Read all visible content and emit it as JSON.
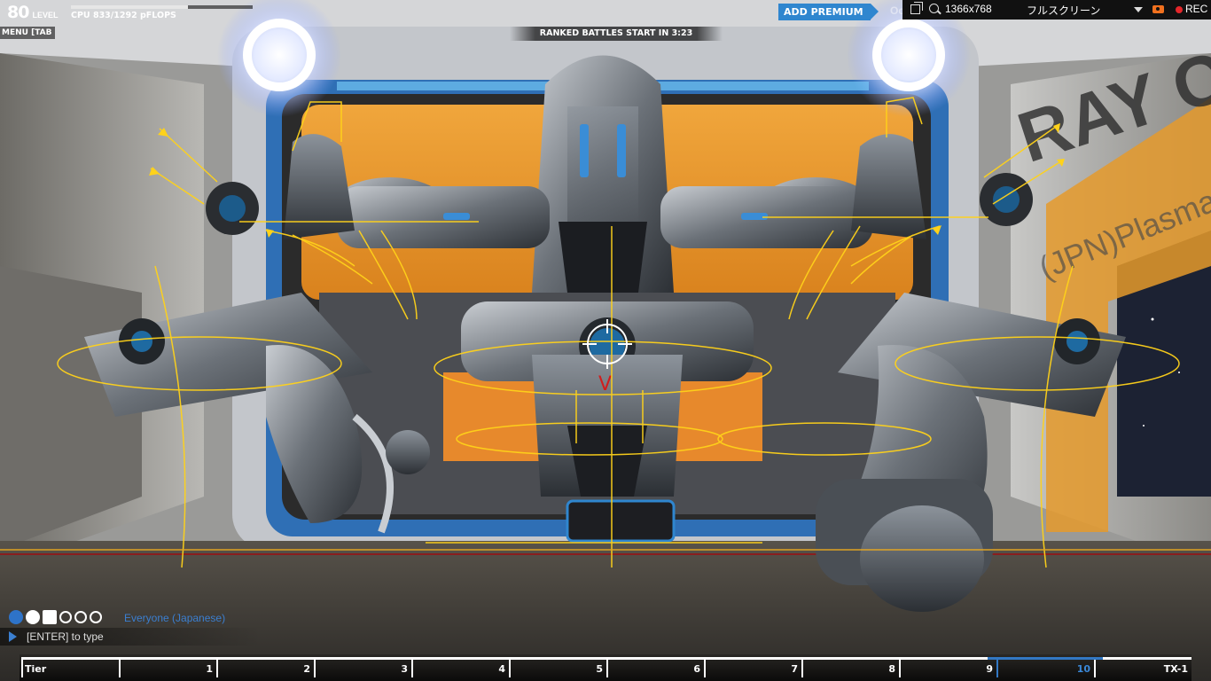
{
  "hud": {
    "level": "80",
    "level_label": "LEVEL",
    "cpu_text": "CPU 833/1292 pFLOPS",
    "cpu_fraction": 0.645,
    "menu_label": "MENU [TAB",
    "ranked_banner": "RANKED BATTLES START IN 3:23",
    "premium_label": "ADD PREMIUM",
    "premium_trail": "Oc"
  },
  "recorder": {
    "resolution": "1366x768",
    "mode": "フルスクリーン",
    "rec_label": "REC",
    "icons": [
      "window-icon",
      "zoom-icon",
      "dropdown-icon",
      "camera-icon",
      "record-dot-icon"
    ]
  },
  "scene": {
    "wall_text": "RAY O",
    "wall_subtext": "(JPN)PlasmaDron"
  },
  "chat": {
    "channel": "Everyone (Japanese)",
    "placeholder": "[ENTER] to type",
    "icons": [
      "globe-icon",
      "gear-person-icon",
      "p-icon",
      "party-1-icon",
      "party-2-icon",
      "party-3-icon"
    ]
  },
  "tiers": {
    "labels": [
      "Tier",
      "1",
      "2",
      "3",
      "4",
      "5",
      "6",
      "7",
      "8",
      "9",
      "10",
      "TX-1"
    ],
    "current": "10",
    "progress_fraction": 0.83
  },
  "colors": {
    "accent_blue": "#2f86cf",
    "rec_red": "#e4262a",
    "camera_orange": "#f0701e",
    "thruster_yellow": "#ffd21a"
  }
}
